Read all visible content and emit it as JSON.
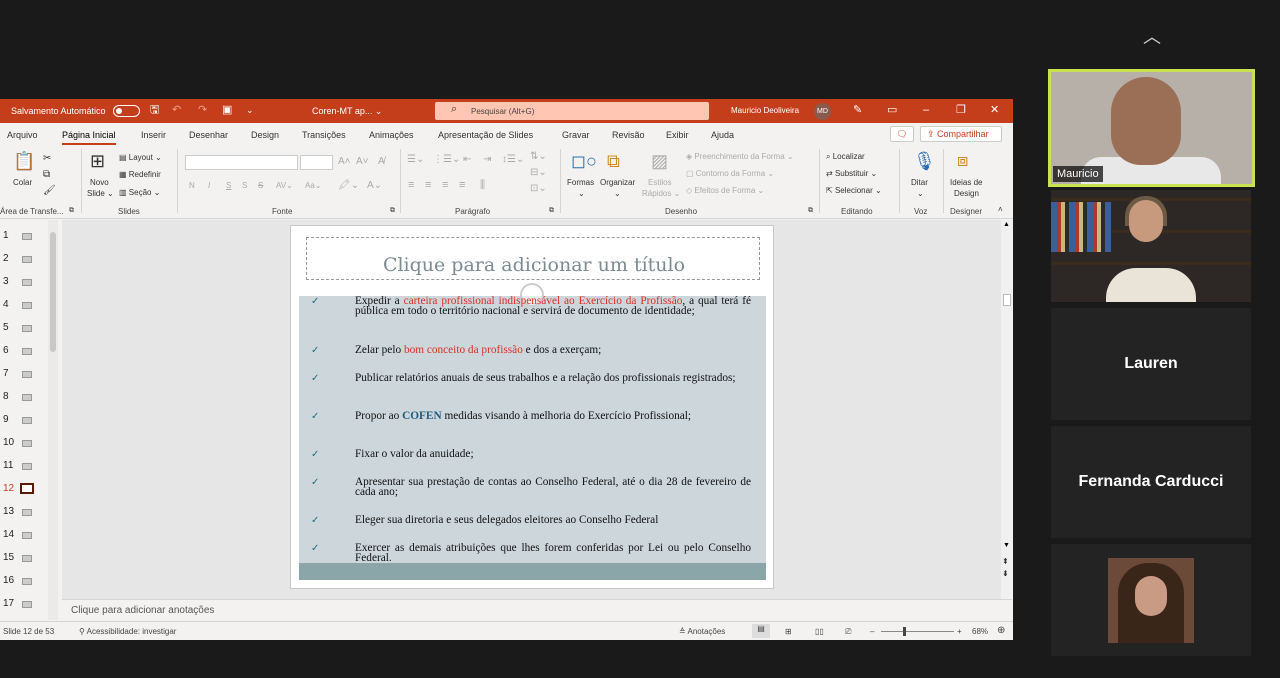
{
  "window": {
    "autosave_label": "Salvamento Automático",
    "doc_title": "Coren-MT ap... ⌄",
    "search_placeholder": "Pesquisar (Alt+G)",
    "user_name": "Mauricio Deoliveira",
    "user_initials": "MD"
  },
  "tabs": [
    "Arquivo",
    "Página Inicial",
    "Inserir",
    "Desenhar",
    "Design",
    "Transições",
    "Animações",
    "Apresentação de Slides",
    "Gravar",
    "Revisão",
    "Exibir",
    "Ajuda"
  ],
  "share_label": "Compartilhar",
  "ribbon": {
    "clipboard": {
      "paste": "Colar",
      "group": "Área de Transfe..."
    },
    "slides": {
      "new_slide_1": "Novo",
      "new_slide_2": "Slide ⌄",
      "layout": "Layout ⌄",
      "reset": "Redefinir",
      "section": "Seção ⌄",
      "group": "Slides"
    },
    "font": {
      "group": "Fonte",
      "bold": "N",
      "italic": "I",
      "underline": "S",
      "strike": "S"
    },
    "paragraph": {
      "group": "Parágrafo"
    },
    "drawing": {
      "shapes": "Formas",
      "arrange": "Organizar",
      "quick_styles_1": "Estilos",
      "quick_styles_2": "Rápidos ⌄",
      "fill": "Preenchimento da Forma ⌄",
      "outline": "Contorno da Forma ⌄",
      "effects": "Efeitos de Forma ⌄",
      "group": "Desenho"
    },
    "editing": {
      "find": "Localizar",
      "replace": "Substituir ⌄",
      "select": "Selecionar ⌄",
      "group": "Editando"
    },
    "voice": {
      "dictate": "Ditar",
      "group": "Voz"
    },
    "designer": {
      "ideas_1": "Ideias de",
      "ideas_2": "Design",
      "group": "Designer"
    }
  },
  "thumbnails": [
    "1",
    "2",
    "3",
    "4",
    "5",
    "6",
    "7",
    "8",
    "9",
    "10",
    "11",
    "12",
    "13",
    "14",
    "15",
    "16",
    "17"
  ],
  "active_slide_index": 11,
  "slide": {
    "title": "Clique para adicionar um título",
    "bullets": [
      {
        "parts": [
          [
            "Expedir a ",
            ""
          ],
          [
            "carteira profissional indispensável ao Exercício da Profissão",
            "red"
          ],
          [
            ", a qual terá fé pública em todo o território nacional e servirá de documento de identidade;",
            ""
          ]
        ]
      },
      {
        "parts": [
          [
            "Zelar pelo ",
            ""
          ],
          [
            "bom conceito da profissão",
            "red"
          ],
          [
            " e dos a exerçam;",
            ""
          ]
        ]
      },
      {
        "parts": [
          [
            "Publicar relatórios anuais de seus trabalhos e a relação dos profissionais registrados;",
            ""
          ]
        ]
      },
      {
        "parts": [
          [
            "Propor ao ",
            ""
          ],
          [
            "COFEN",
            "blue"
          ],
          [
            " medidas visando à melhoria do Exercício Profissional;",
            ""
          ]
        ]
      },
      {
        "parts": [
          [
            "Fixar o valor da anuidade;",
            ""
          ]
        ]
      },
      {
        "parts": [
          [
            "Apresentar sua prestação de contas ao Conselho Federal, até o dia 28 de fevereiro de cada ano;",
            ""
          ]
        ]
      },
      {
        "parts": [
          [
            "Eleger sua diretoria e seus delegados eleitores ao Conselho Federal",
            ""
          ]
        ]
      },
      {
        "parts": [
          [
            "Exercer as demais atribuições que lhes forem conferidas por Lei ou pelo Conselho Federal.",
            ""
          ]
        ]
      }
    ]
  },
  "notes_placeholder": "Clique para adicionar anotações",
  "status": {
    "slide_count": "Slide 12 de 53",
    "accessibility": "Acessibilidade: investigar",
    "notes": "Anotações",
    "zoom": "68%"
  },
  "participants": {
    "p1": "Mauricio",
    "p3": "Lauren",
    "p4": "Fernanda Carducci"
  },
  "colors": {
    "ppt_accent": "#c43e1c",
    "active_speaker_border": "#c9e24f"
  }
}
